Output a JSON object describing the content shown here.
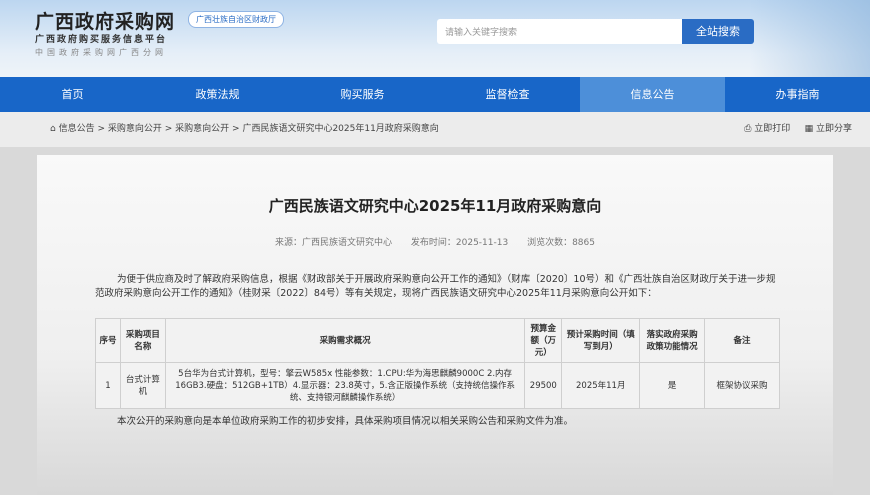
{
  "header": {
    "site_title": "广西政府采购网",
    "badge": "广西壮族自治区财政厅",
    "subtitle": "广西政府购买服务信息平台",
    "subtitle2": "中国政府采购网广西分网",
    "search_placeholder": "请输入关键字搜索",
    "search_button": "全站搜索"
  },
  "nav": [
    "首页",
    "政策法规",
    "购买服务",
    "监督检查",
    "信息公告",
    "办事指南"
  ],
  "breadcrumb": {
    "items": [
      "信息公告",
      "采购意向公开",
      "采购意向公开",
      "广西民族语文研究中心2025年11月政府采购意向"
    ],
    "print": "立即打印",
    "share": "立即分享"
  },
  "article": {
    "title": "广西民族语文研究中心2025年11月政府采购意向",
    "source": "来源：广西民族语文研究中心",
    "date": "发布时间：2025-11-13",
    "views": "浏览次数：8865",
    "intro": "为便于供应商及时了解政府采购信息，根据《财政部关于开展政府采购意向公开工作的通知》（财库〔2020〕10号）和《广西壮族自治区财政厅关于进一步规范政府采购意向公开工作的通知》（桂财采〔2022〕84号）等有关规定，现将广西民族语文研究中心2025年11月采购意向公开如下：",
    "table": {
      "headers": [
        "序号",
        "采购项目名称",
        "采购需求概况",
        "预算金额（万元）",
        "预计采购时间（填写到月）",
        "落实政府采购政策功能情况",
        "备注"
      ],
      "rows": [
        [
          "1",
          "台式计算机",
          "5台华为台式计算机，型号：擎云W585x 性能参数：1.CPU:华为海思麒麟9000C 2.内存16GB3.硬盘：512GB+1TB）4.显示器：23.8英寸，5.含正版操作系统（支持统信操作系统、支持银河麒麟操作系统）",
          "29500",
          "2025年11月",
          "是",
          "框架协议采购"
        ]
      ]
    },
    "footer": "本次公开的采购意向是本单位政府采购工作的初步安排，具体采购项目情况以相关采购公告和采购文件为准。"
  }
}
